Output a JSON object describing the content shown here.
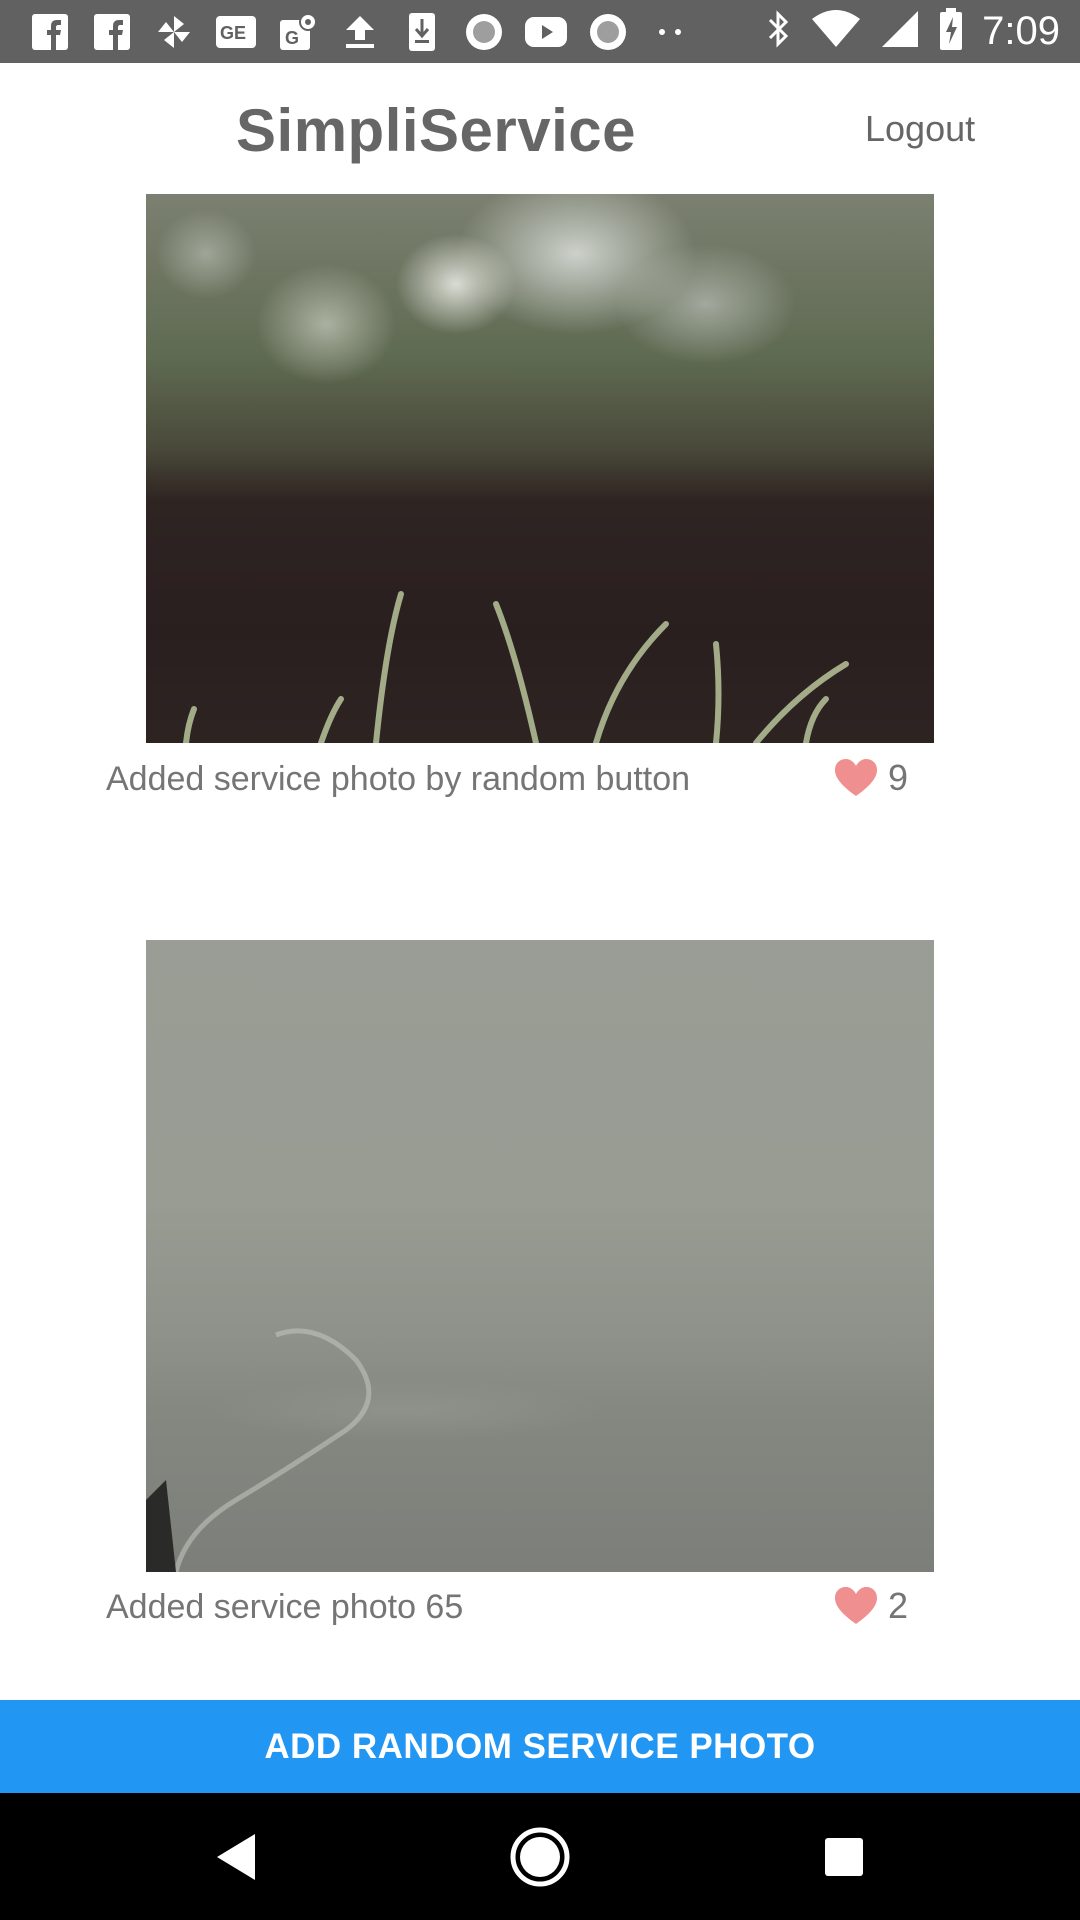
{
  "status_bar": {
    "time": "7:09",
    "left_icons": [
      "facebook-icon",
      "facebook-icon",
      "pinwheel-icon",
      "ge-icon",
      "google-maps-icon",
      "upload-icon",
      "download-icon",
      "circle-icon",
      "youtube-icon",
      "circle-icon",
      "more-dots-icon"
    ],
    "right_icons": [
      "bluetooth-icon",
      "wifi-icon",
      "cell-signal-icon",
      "battery-charging-icon"
    ]
  },
  "header": {
    "title": "SimpliService",
    "logout_label": "Logout"
  },
  "feed": [
    {
      "caption": "Added service photo by random button",
      "likes": "9"
    },
    {
      "caption": "Added service photo 65",
      "likes": "2"
    }
  ],
  "add_button_label": "ADD RANDOM SERVICE PHOTO",
  "nav_bar": {
    "icons": [
      "back-icon",
      "home-icon",
      "recents-icon"
    ]
  },
  "colors": {
    "accent": "#2196f3",
    "heart": "#ef8f8f",
    "status_bar": "#616161",
    "text": "#666666"
  }
}
